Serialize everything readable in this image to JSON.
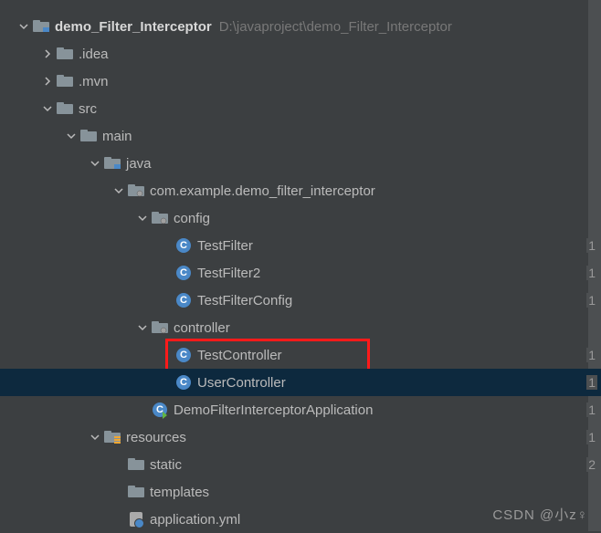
{
  "root": {
    "name": "demo_Filter_Interceptor",
    "path": "D:\\javaproject\\demo_Filter_Interceptor"
  },
  "tree": {
    "idea": ".idea",
    "mvn": ".mvn",
    "src": "src",
    "main": "main",
    "java": "java",
    "pkg": "com.example.demo_filter_interceptor",
    "config": "config",
    "testFilter": "TestFilter",
    "testFilter2": "TestFilter2",
    "testFilterConfig": "TestFilterConfig",
    "controller": "controller",
    "testController": "TestController",
    "userController": "UserController",
    "app": "DemoFilterInterceptorApplication",
    "resources": "resources",
    "static": "static",
    "templates": "templates",
    "appYml": "application.yml"
  },
  "gutter": {
    "g1": "1",
    "g2": "1",
    "g3": "1",
    "g4": "1",
    "g5": "1",
    "g6": "1",
    "g7": "1",
    "g8": "2"
  },
  "watermark": "CSDN @小z♀"
}
